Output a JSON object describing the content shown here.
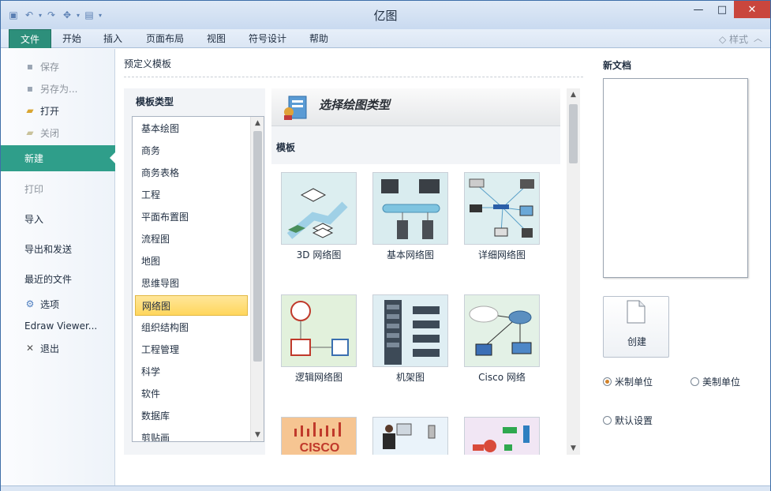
{
  "window": {
    "title": "亿图",
    "controls": {
      "minimize": "—",
      "maximize": "□",
      "close": "✕"
    }
  },
  "ribbon": {
    "tabs": [
      "文件",
      "开始",
      "插入",
      "页面布局",
      "视图",
      "符号设计",
      "帮助"
    ],
    "active_tab": "文件",
    "style_label": "样式"
  },
  "nav": {
    "items": [
      {
        "label": "保存",
        "icon": "save-icon",
        "enabled": false
      },
      {
        "label": "另存为...",
        "icon": "save-as-icon",
        "enabled": false
      },
      {
        "label": "打开",
        "icon": "open-folder-icon",
        "enabled": true
      },
      {
        "label": "关闭",
        "icon": "close-folder-icon",
        "enabled": false
      },
      {
        "label": "新建",
        "enabled": true,
        "active": true
      },
      {
        "label": "打印",
        "enabled": false
      },
      {
        "label": "导入",
        "enabled": true
      },
      {
        "label": "导出和发送",
        "enabled": true
      },
      {
        "label": "最近的文件",
        "enabled": true
      },
      {
        "label": "选项",
        "icon": "options-icon",
        "enabled": true
      },
      {
        "label": "Edraw Viewer...",
        "enabled": true
      },
      {
        "label": "退出",
        "icon": "exit-icon",
        "enabled": true
      }
    ]
  },
  "content": {
    "heading": "预定义模板",
    "category_heading": "模板类型",
    "categories": [
      "基本绘图",
      "商务",
      "商务表格",
      "工程",
      "平面布置图",
      "流程图",
      "地图",
      "思维导图",
      "网络图",
      "组织结构图",
      "工程管理",
      "科学",
      "软件",
      "数据库",
      "剪贴画"
    ],
    "selected_category": "网络图",
    "banner_title": "选择绘图类型",
    "templates_label": "模板",
    "templates": [
      "3D 网络图",
      "基本网络图",
      "详细网络图",
      "逻辑网络图",
      "机架图",
      "Cisco 网络"
    ],
    "cisco_logo_text": "CISCO"
  },
  "right_panel": {
    "heading": "新文档",
    "create_label": "创建",
    "units": {
      "metric": "米制单位",
      "imperial": "美制单位",
      "selected": "metric"
    },
    "default_settings": "默认设置"
  },
  "colors": {
    "file_tab": "#2d8f7b",
    "nav_active": "#2f9e8a",
    "selection": "#ffd65c",
    "close_button": "#c9463d"
  }
}
